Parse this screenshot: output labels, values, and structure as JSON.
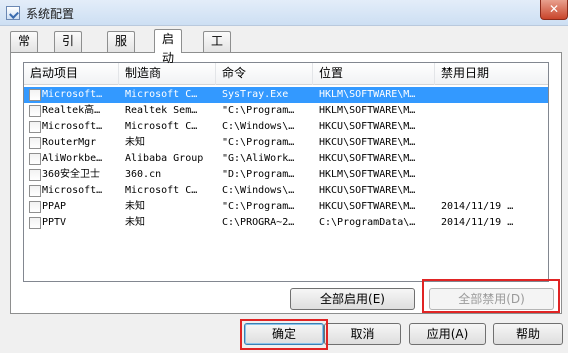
{
  "window": {
    "title": "系统配置",
    "close_label": "✕"
  },
  "tabs": [
    "常规",
    "引导",
    "服务",
    "启动",
    "工具"
  ],
  "startup": {
    "columns": [
      "启动项目",
      "制造商",
      "命令",
      "位置",
      "禁用日期"
    ],
    "rows": [
      {
        "item": "Microsoft…",
        "maker": "Microsoft C…",
        "command": "SysTray.Exe",
        "location": "HKLM\\SOFTWARE\\M…",
        "date": ""
      },
      {
        "item": "Realtek高…",
        "maker": "Realtek Sem…",
        "command": "\"C:\\Program…",
        "location": "HKLM\\SOFTWARE\\M…",
        "date": ""
      },
      {
        "item": "Microsoft…",
        "maker": "Microsoft C…",
        "command": "C:\\Windows\\…",
        "location": "HKCU\\SOFTWARE\\M…",
        "date": ""
      },
      {
        "item": "RouterMgr",
        "maker": "未知",
        "command": "\"C:\\Program…",
        "location": "HKCU\\SOFTWARE\\M…",
        "date": ""
      },
      {
        "item": "AliWorkbe…",
        "maker": "Alibaba Group",
        "command": "\"G:\\AliWork…",
        "location": "HKCU\\SOFTWARE\\M…",
        "date": ""
      },
      {
        "item": "360安全卫士",
        "maker": "360.cn",
        "command": "\"D:\\Program…",
        "location": "HKLM\\SOFTWARE\\M…",
        "date": ""
      },
      {
        "item": "Microsoft…",
        "maker": "Microsoft C…",
        "command": "C:\\Windows\\…",
        "location": "HKCU\\SOFTWARE\\M…",
        "date": ""
      },
      {
        "item": "PPAP",
        "maker": "未知",
        "command": "\"C:\\Program…",
        "location": "HKCU\\SOFTWARE\\M…",
        "date": "2014/11/19 …"
      },
      {
        "item": "PPTV",
        "maker": "未知",
        "command": "C:\\PROGRA~2…",
        "location": "C:\\ProgramData\\…",
        "date": "2014/11/19 …"
      }
    ]
  },
  "buttons": {
    "enable_all": "全部启用(E)",
    "disable_all": "全部禁用(D)",
    "ok": "确定",
    "cancel": "取消",
    "apply": "应用(A)",
    "help": "帮助"
  },
  "colors": {
    "highlight": "#e02424",
    "selection": "#3399ff"
  }
}
